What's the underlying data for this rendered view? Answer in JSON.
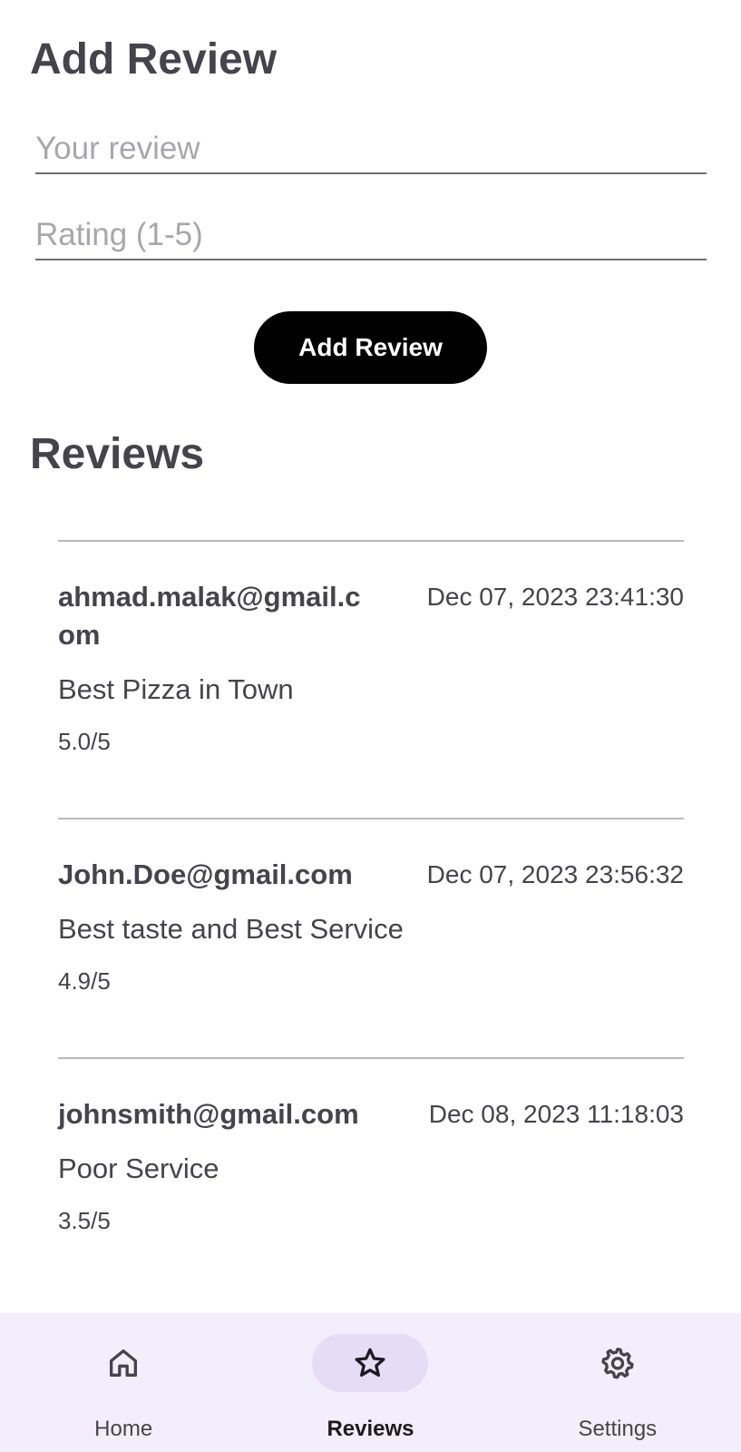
{
  "add_review": {
    "title": "Add Review",
    "review_placeholder": "Your review",
    "review_value": "",
    "rating_placeholder": "Rating (1-5)",
    "rating_value": "",
    "button_label": "Add Review"
  },
  "reviews": {
    "title": "Reviews",
    "items": [
      {
        "email": "ahmad.malak@gmail.com",
        "date": "Dec 07, 2023 23:41:30",
        "text": "Best Pizza in Town",
        "rating": "5.0/5"
      },
      {
        "email": "John.Doe@gmail.com",
        "date": "Dec 07, 2023 23:56:32",
        "text": "Best taste and Best Service",
        "rating": "4.9/5"
      },
      {
        "email": "johnsmith@gmail.com",
        "date": "Dec 08, 2023 11:18:03",
        "text": "Poor Service",
        "rating": "3.5/5"
      }
    ]
  },
  "nav": {
    "active": "Reviews",
    "items": [
      {
        "label": "Home",
        "icon": "home-icon"
      },
      {
        "label": "Reviews",
        "icon": "star-icon"
      },
      {
        "label": "Settings",
        "icon": "gear-icon"
      }
    ]
  },
  "colors": {
    "text": "#45444d",
    "button_bg": "#000000",
    "nav_bg": "#f3eefb",
    "nav_active_pill": "#e7dcf6"
  }
}
